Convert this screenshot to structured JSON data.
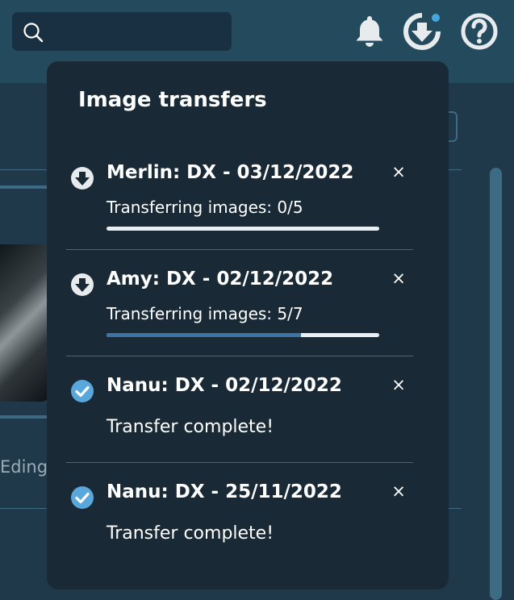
{
  "header": {
    "search": {
      "placeholder": "",
      "value": ""
    },
    "icons": [
      "bell-icon",
      "download-icon",
      "help-icon"
    ],
    "download_badge_color": "#47a6db"
  },
  "background": {
    "partial_name": "Edinge"
  },
  "popover": {
    "title": "Image transfers",
    "items": [
      {
        "title": "Merlin: DX - 03/12/2022",
        "status": "Transferring images: 0/5",
        "state": "transferring",
        "icon": "download-icon",
        "transferred": 0,
        "total": 5
      },
      {
        "title": "Amy: DX - 02/12/2022",
        "status": "Transferring images: 5/7",
        "state": "transferring",
        "icon": "download-icon",
        "transferred": 5,
        "total": 7
      },
      {
        "title": "Nanu: DX - 02/12/2022",
        "status": "Transfer complete!",
        "state": "complete",
        "icon": "check-icon"
      },
      {
        "title": "Nanu: DX - 25/11/2022",
        "status": "Transfer complete!",
        "state": "complete",
        "icon": "check-icon"
      }
    ],
    "close_label": "×"
  },
  "colors": {
    "accent": "#3a74a6",
    "check": "#5aa8db",
    "panel": "#192a36",
    "topbar": "#234a5d"
  }
}
